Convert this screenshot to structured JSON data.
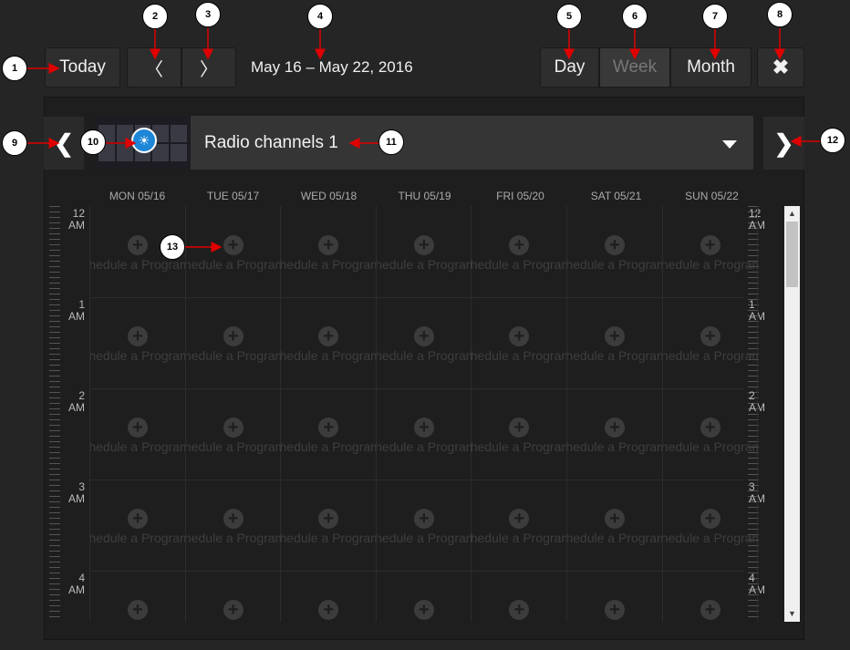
{
  "toolbar": {
    "today_label": "Today",
    "prev_icon": "chevron-left-icon",
    "next_icon": "chevron-right-icon",
    "prev_glyph": "〈",
    "next_glyph": "〉",
    "date_range": "May 16 – May 22, 2016",
    "view_day": "Day",
    "view_week": "Week",
    "view_month": "Month",
    "active_view": "Week",
    "close_glyph": "✖"
  },
  "channel_bar": {
    "prev_glyph": "❮",
    "next_glyph": "❯",
    "channel_name": "Radio channels 1"
  },
  "calendar": {
    "days": [
      "MON 05/16",
      "TUE 05/17",
      "WED 05/18",
      "THU 05/19",
      "FRI 05/20",
      "SAT 05/21",
      "SUN 05/22"
    ],
    "hours": [
      {
        "num": "12",
        "ampm": "AM"
      },
      {
        "num": "1",
        "ampm": "AM"
      },
      {
        "num": "2",
        "ampm": "AM"
      },
      {
        "num": "3",
        "ampm": "AM"
      },
      {
        "num": "4",
        "ampm": "AM"
      }
    ],
    "cell_label": "Schedule a Program",
    "cell_glyph": "+"
  },
  "callouts": [
    "1",
    "2",
    "3",
    "4",
    "5",
    "6",
    "7",
    "8",
    "9",
    "10",
    "11",
    "12",
    "13"
  ],
  "colors": {
    "background": "#252525",
    "callout_arrow": "#e00000",
    "accent_blue": "#1e86d6"
  }
}
